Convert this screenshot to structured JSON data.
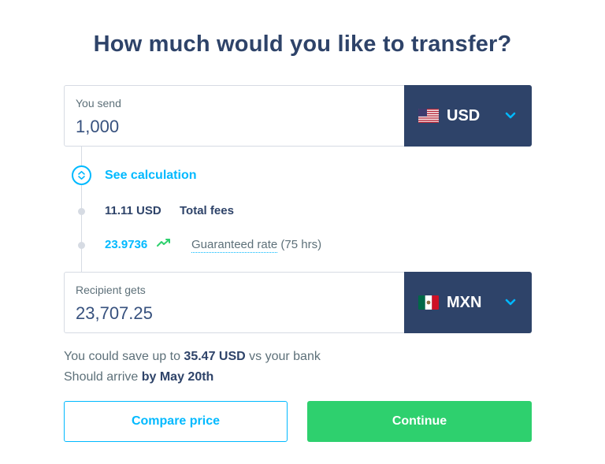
{
  "title": "How much would you like to transfer?",
  "send": {
    "label": "You send",
    "amount": "1,000",
    "currency": "USD",
    "flag_icon": "us-flag-icon"
  },
  "calculation": {
    "see_calculation": "See calculation",
    "fee_amount": "11.11 USD",
    "fee_label": "Total fees",
    "rate": "23.9736",
    "rate_label": "Guaranteed rate",
    "rate_duration": "(75 hrs)"
  },
  "receive": {
    "label": "Recipient gets",
    "amount": "23,707.25",
    "currency": "MXN",
    "flag_icon": "mx-flag-icon"
  },
  "savings": {
    "prefix": "You could save up to",
    "amount": "35.47 USD",
    "suffix": "vs your bank"
  },
  "arrival": {
    "prefix": "Should arrive",
    "date": "by May 20th"
  },
  "buttons": {
    "compare": "Compare price",
    "continue": "Continue"
  },
  "colors": {
    "navy": "#2e4369",
    "accent_blue": "#00b9ff",
    "green": "#2ed06e",
    "trend_green": "#2ed06e"
  }
}
